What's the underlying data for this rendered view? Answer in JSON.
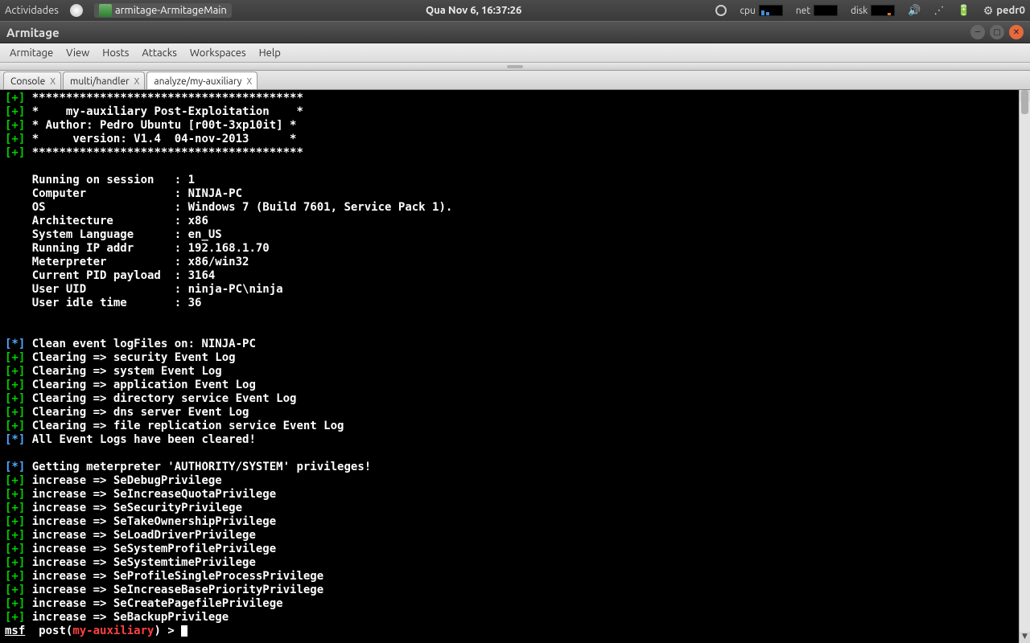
{
  "panel": {
    "activities": "Actividades",
    "task_title": "armitage-ArmitageMain",
    "clock": "Qua Nov  6, 16:37:26",
    "ind_cpu": "cpu",
    "ind_net": "net",
    "ind_disk": "disk",
    "user": "pedr0"
  },
  "window": {
    "title": "Armitage"
  },
  "menu": {
    "armitage": "Armitage",
    "view": "View",
    "hosts": "Hosts",
    "attacks": "Attacks",
    "workspaces": "Workspaces",
    "help": "Help"
  },
  "tabs": {
    "t1": "Console",
    "t2": "multi/handler",
    "t3": "analyze/my-auxiliary",
    "close": "X"
  },
  "console": {
    "banner": {
      "name": "my-auxiliary Post-Exploitation",
      "author": "Author: Pedro Ubuntu [r00t-3xp10it]",
      "version": "version: V1.4  04-nov-2013"
    },
    "info": {
      "session_lbl": "Running on session",
      "session": "1",
      "computer_lbl": "Computer",
      "computer": "NINJA-PC",
      "os_lbl": "OS",
      "os": "Windows 7 (Build 7601, Service Pack 1).",
      "arch_lbl": "Architecture",
      "arch": "x86",
      "lang_lbl": "System Language",
      "lang": "en_US",
      "ip_lbl": "Running IP addr",
      "ip": "192.168.1.70",
      "met_lbl": "Meterpreter",
      "met": "x86/win32",
      "pid_lbl": "Current PID payload",
      "pid": "3164",
      "uid_lbl": "User UID",
      "uid": "ninja-PC\\ninja",
      "idle_lbl": "User idle time",
      "idle": "36"
    },
    "clean_header": "Clean event logFiles on: NINJA-PC",
    "clean": {
      "c1": "Clearing => security Event Log",
      "c2": "Clearing => system Event Log",
      "c3": "Clearing => application Event Log",
      "c4": "Clearing => directory service Event Log",
      "c5": "Clearing => dns server Event Log",
      "c6": "Clearing => file replication service Event Log"
    },
    "clean_done": "All Event Logs have been cleared!",
    "priv_header": "Getting meterpreter 'AUTHORITY/SYSTEM' privileges!",
    "priv": {
      "p1": "increase => SeDebugPrivilege",
      "p2": "increase => SeIncreaseQuotaPrivilege",
      "p3": "increase => SeSecurityPrivilege",
      "p4": "increase => SeTakeOwnershipPrivilege",
      "p5": "increase => SeLoadDriverPrivilege",
      "p6": "increase => SeSystemProfilePrivilege",
      "p7": "increase => SeSystemtimePrivilege",
      "p8": "increase => SeProfileSingleProcessPrivilege",
      "p9": "increase => SeIncreaseBasePriorityPrivilege",
      "p10": "increase => SeCreatePagefilePrivilege",
      "p11": "increase => SeBackupPrivilege"
    },
    "prompt": {
      "msf": "msf",
      "post": "  post(",
      "mod": "my-auxiliary",
      "tail": ") > "
    }
  }
}
